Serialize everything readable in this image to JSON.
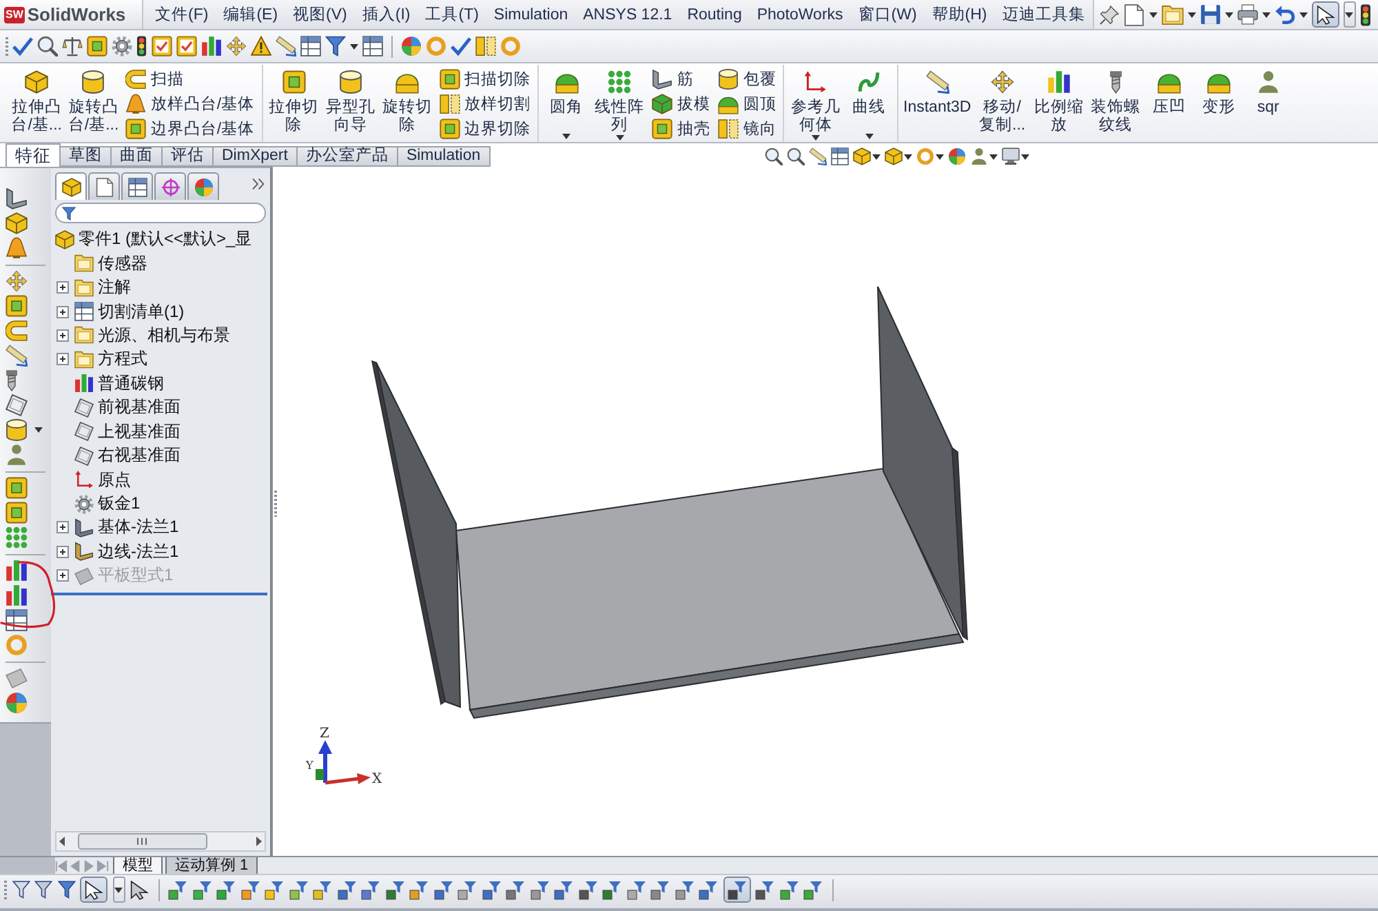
{
  "title_bar": {
    "logo_badge": "SW",
    "logo": "SolidWorks"
  },
  "menu": [
    "文件(F)",
    "编辑(E)",
    "视图(V)",
    "插入(I)",
    "工具(T)",
    "Simulation",
    "ANSYS 12.1",
    "Routing",
    "PhotoWorks",
    "窗口(W)",
    "帮助(H)",
    "迈迪工具集"
  ],
  "standard_toolbar": {
    "select_tool_active": true
  },
  "ribbon_groups": [
    {
      "items": [
        {
          "kind": "large",
          "label": "拉伸凸台/基...",
          "dropdown": false
        },
        {
          "kind": "large",
          "label": "旋转凸台/基...",
          "dropdown": false
        },
        {
          "kind": "stack",
          "items": [
            "扫描",
            "放样凸台/基体",
            "边界凸台/基体"
          ]
        }
      ]
    },
    {
      "items": [
        {
          "kind": "large",
          "label": "拉伸切除",
          "dropdown": false
        },
        {
          "kind": "large",
          "label": "异型孔向导",
          "dropdown": false
        },
        {
          "kind": "large",
          "label": "旋转切除",
          "dropdown": false
        },
        {
          "kind": "stack",
          "items": [
            "扫描切除",
            "放样切割",
            "边界切除"
          ]
        }
      ]
    },
    {
      "items": [
        {
          "kind": "large",
          "label": "圆角",
          "dropdown": true
        },
        {
          "kind": "large",
          "label": "线性阵列",
          "dropdown": true
        },
        {
          "kind": "stack",
          "items": [
            "筋",
            "拔模",
            "抽壳"
          ]
        },
        {
          "kind": "stack",
          "items": [
            "包覆",
            "圆顶",
            "镜向"
          ]
        }
      ]
    },
    {
      "items": [
        {
          "kind": "large",
          "label": "参考几何体",
          "dropdown": true
        },
        {
          "kind": "large",
          "label": "曲线",
          "dropdown": true
        }
      ]
    },
    {
      "items": [
        {
          "kind": "large",
          "label": "Instant3D",
          "dropdown": false
        },
        {
          "kind": "large",
          "label": "移动/复制...",
          "dropdown": false
        },
        {
          "kind": "large",
          "label": "比例缩放",
          "dropdown": false
        },
        {
          "kind": "large",
          "label": "装饰螺纹线",
          "dropdown": false
        },
        {
          "kind": "large",
          "label": "压凹",
          "dropdown": false
        },
        {
          "kind": "large",
          "label": "变形",
          "dropdown": false
        },
        {
          "kind": "large",
          "label": "sqr",
          "dropdown": false
        }
      ]
    }
  ],
  "tabs": [
    {
      "label": "特征",
      "selected": true
    },
    {
      "label": "草图",
      "selected": false
    },
    {
      "label": "曲面",
      "selected": false
    },
    {
      "label": "评估",
      "selected": false
    },
    {
      "label": "DimXpert",
      "selected": false
    },
    {
      "label": "办公室产品",
      "selected": false
    },
    {
      "label": "Simulation",
      "selected": false
    }
  ],
  "feature_manager": {
    "tabs": [
      {
        "kind": "feature-tree",
        "selected": true
      },
      {
        "kind": "property",
        "selected": false
      },
      {
        "kind": "configuration",
        "selected": false
      },
      {
        "kind": "dimxpert",
        "selected": false
      },
      {
        "kind": "display",
        "selected": false
      }
    ],
    "tree": {
      "kind": "part",
      "label": "零件1 (默认<<默认>_显",
      "children": [
        {
          "kind": "sensors",
          "label": "传感器",
          "expandable": false,
          "suppressed": false
        },
        {
          "kind": "annotations",
          "label": "注解",
          "expandable": true,
          "suppressed": false
        },
        {
          "kind": "cut-list",
          "label": "切割清单(1)",
          "expandable": true,
          "suppressed": false
        },
        {
          "kind": "lights",
          "label": "光源、相机与布景",
          "expandable": true,
          "suppressed": false
        },
        {
          "kind": "equations",
          "label": "方程式",
          "expandable": true,
          "suppressed": false
        },
        {
          "kind": "material",
          "label": "普通碳钢",
          "expandable": false,
          "suppressed": false
        },
        {
          "kind": "plane",
          "label": "前视基准面",
          "expandable": false,
          "suppressed": false
        },
        {
          "kind": "plane",
          "label": "上视基准面",
          "expandable": false,
          "suppressed": false
        },
        {
          "kind": "plane",
          "label": "右视基准面",
          "expandable": false,
          "suppressed": false
        },
        {
          "kind": "origin",
          "label": "原点",
          "expandable": false,
          "suppressed": false
        },
        {
          "kind": "sheet-metal",
          "label": "钣金1",
          "expandable": false,
          "suppressed": false
        },
        {
          "kind": "base-flange",
          "label": "基体-法兰1",
          "expandable": true,
          "suppressed": false
        },
        {
          "kind": "edge-flange",
          "label": "边线-法兰1",
          "expandable": true,
          "suppressed": false
        },
        {
          "kind": "flat-pattern",
          "label": "平板型式1",
          "expandable": true,
          "suppressed": true
        }
      ]
    }
  },
  "viewport": {
    "triad": {
      "z": "Z",
      "y": "Y",
      "x": "X"
    }
  },
  "bottom_tabs": [
    {
      "label": "模型",
      "selected": true
    },
    {
      "label": "运动算例 1",
      "selected": false
    }
  ],
  "selection_toolbar": {
    "select_tool_active": true,
    "note_filter_active": true
  }
}
